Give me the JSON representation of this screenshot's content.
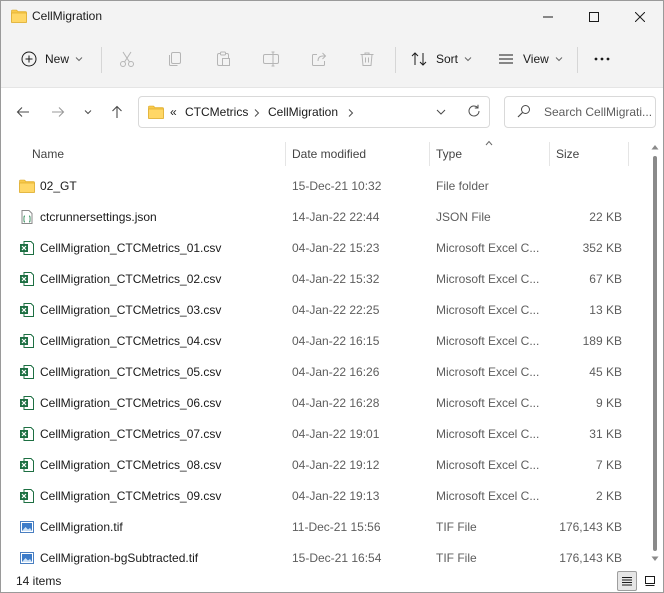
{
  "window": {
    "title": "CellMigration",
    "controls": {
      "minimize": "minimize",
      "maximize": "maximize",
      "close": "close"
    }
  },
  "toolbar": {
    "new_label": "New",
    "sort_label": "Sort",
    "view_label": "View",
    "icons": [
      "plus-icon",
      "cut-icon",
      "copy-icon",
      "paste-icon",
      "rename-icon",
      "share-icon",
      "delete-icon",
      "sort-icon",
      "view-icon",
      "more-icon"
    ]
  },
  "address": {
    "overflow": "«",
    "crumbs": [
      "CTCMetrics",
      "CellMigration"
    ],
    "search_placeholder": "Search CellMigrati..."
  },
  "columns": {
    "name": "Name",
    "date": "Date modified",
    "type": "Type",
    "size": "Size"
  },
  "files": [
    {
      "name": "02_GT",
      "date": "15-Dec-21 10:32",
      "type": "File folder",
      "size": "",
      "icon": "folder-icon"
    },
    {
      "name": "ctcrunnersettings.json",
      "date": "14-Jan-22 22:44",
      "type": "JSON File",
      "size": "22 KB",
      "icon": "json-file-icon"
    },
    {
      "name": "CellMigration_CTCMetrics_01.csv",
      "date": "04-Jan-22 15:23",
      "type": "Microsoft Excel C...",
      "size": "352 KB",
      "icon": "excel-csv-icon"
    },
    {
      "name": "CellMigration_CTCMetrics_02.csv",
      "date": "04-Jan-22 15:32",
      "type": "Microsoft Excel C...",
      "size": "67 KB",
      "icon": "excel-csv-icon"
    },
    {
      "name": "CellMigration_CTCMetrics_03.csv",
      "date": "04-Jan-22 22:25",
      "type": "Microsoft Excel C...",
      "size": "13 KB",
      "icon": "excel-csv-icon"
    },
    {
      "name": "CellMigration_CTCMetrics_04.csv",
      "date": "04-Jan-22 16:15",
      "type": "Microsoft Excel C...",
      "size": "189 KB",
      "icon": "excel-csv-icon"
    },
    {
      "name": "CellMigration_CTCMetrics_05.csv",
      "date": "04-Jan-22 16:26",
      "type": "Microsoft Excel C...",
      "size": "45 KB",
      "icon": "excel-csv-icon"
    },
    {
      "name": "CellMigration_CTCMetrics_06.csv",
      "date": "04-Jan-22 16:28",
      "type": "Microsoft Excel C...",
      "size": "9 KB",
      "icon": "excel-csv-icon"
    },
    {
      "name": "CellMigration_CTCMetrics_07.csv",
      "date": "04-Jan-22 19:01",
      "type": "Microsoft Excel C...",
      "size": "31 KB",
      "icon": "excel-csv-icon"
    },
    {
      "name": "CellMigration_CTCMetrics_08.csv",
      "date": "04-Jan-22 19:12",
      "type": "Microsoft Excel C...",
      "size": "7 KB",
      "icon": "excel-csv-icon"
    },
    {
      "name": "CellMigration_CTCMetrics_09.csv",
      "date": "04-Jan-22 19:13",
      "type": "Microsoft Excel C...",
      "size": "2 KB",
      "icon": "excel-csv-icon"
    },
    {
      "name": "CellMigration.tif",
      "date": "11-Dec-21 15:56",
      "type": "TIF File",
      "size": "176,143 KB",
      "icon": "image-file-icon"
    },
    {
      "name": "CellMigration-bgSubtracted.tif",
      "date": "15-Dec-21 16:54",
      "type": "TIF File",
      "size": "176,143 KB",
      "icon": "image-file-icon"
    }
  ],
  "status": {
    "item_count": "14 items"
  },
  "colors": {
    "folder": "#f8c94c",
    "excel": "#1d6f42",
    "accent": "#0067c0"
  }
}
